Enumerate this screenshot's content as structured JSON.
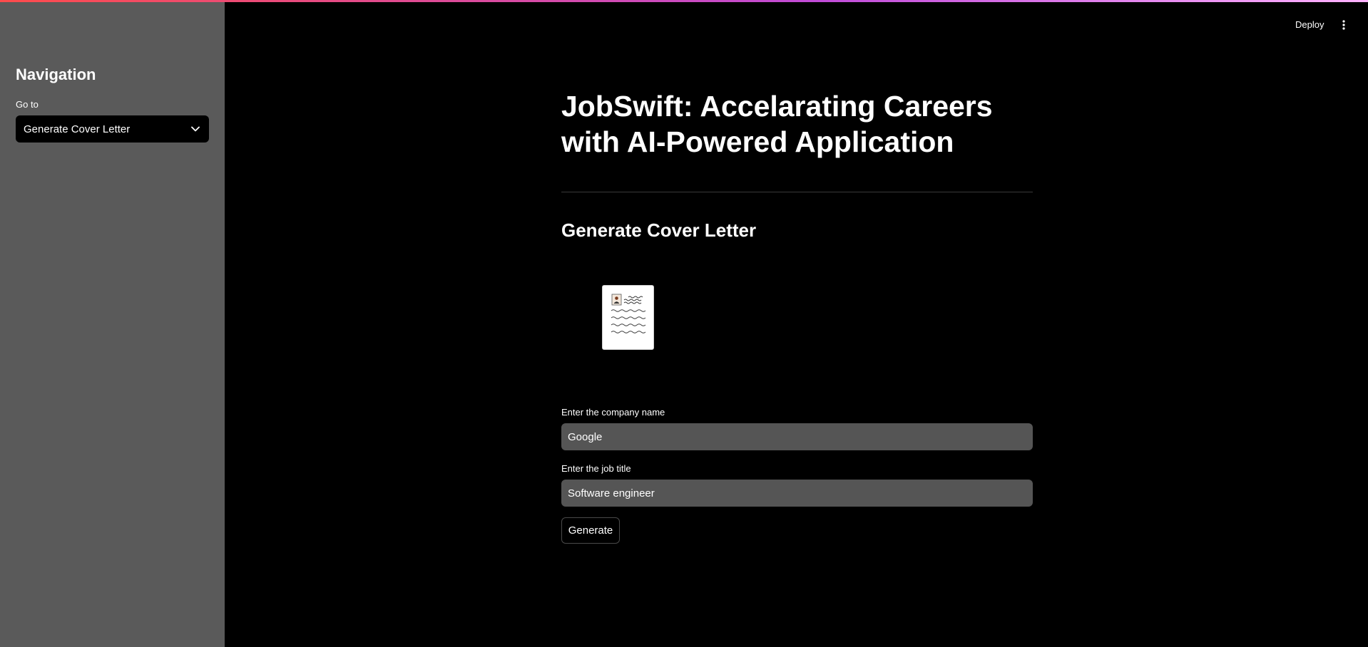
{
  "sidebar": {
    "heading": "Navigation",
    "select_label": "Go to",
    "selected_page": "Generate Cover Letter"
  },
  "header": {
    "deploy_label": "Deploy",
    "menu_icon": "kebab-menu-icon"
  },
  "main": {
    "title": "JobSwift: Accelarating Careers with AI-Powered Application",
    "subtitle": "Generate Cover Letter",
    "image_icon": "cover-letter-document-icon",
    "fields": {
      "company_label": "Enter the company name",
      "company_value": "Google",
      "job_label": "Enter the job title",
      "job_value": "Software engineer"
    },
    "generate_button": "Generate"
  },
  "colors": {
    "sidebar_bg": "#5a5a5a",
    "main_bg": "#000000",
    "input_bg": "#555555",
    "accent_gradient_start": "#ff4b4b",
    "accent_gradient_end": "#ffb3ff"
  }
}
